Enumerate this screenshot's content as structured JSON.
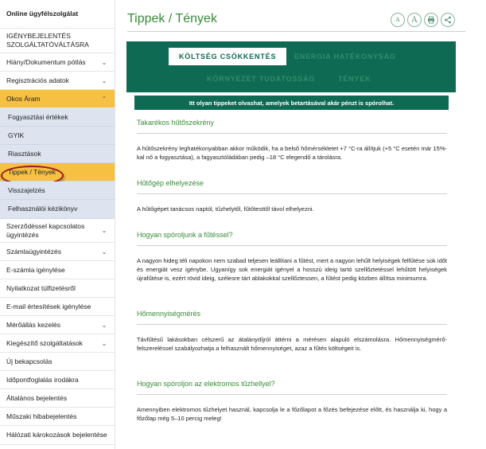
{
  "sidebar": {
    "items": [
      {
        "label": "Online ügyfélszolgálat",
        "bold": true
      },
      {
        "label": "IGÉNYBEJELENTÉS SZOLGÁLTATÓVÁLTÁSRA"
      },
      {
        "label": "Hiány/Dokumentum pótlás",
        "chevron": true
      },
      {
        "label": "Regisztrációs adatok",
        "chevron": true
      },
      {
        "label": "Okos Áram",
        "chevron": "up",
        "active": true
      },
      {
        "label": "Fogyasztási értékek",
        "sub": true
      },
      {
        "label": "GYIK",
        "sub": true
      },
      {
        "label": "Riasztások",
        "sub": true
      },
      {
        "label": "Tippek / Tények",
        "sub": true,
        "current": true
      },
      {
        "label": "Visszajelzés",
        "sub": true
      },
      {
        "label": "Felhasználói kézikönyv",
        "sub": true
      },
      {
        "label": "Szerződéssel kapcsolatos ügyintézés",
        "chevron": true
      },
      {
        "label": "Számlaügyintézés",
        "chevron": true
      },
      {
        "label": "E-számla igénylése"
      },
      {
        "label": "Nyilatkozat túlfizetésről"
      },
      {
        "label": "E-mail értesítések igénylése"
      },
      {
        "label": "Mérőállás kezelés",
        "chevron": true
      },
      {
        "label": "Kiegészítő szolgáltatások",
        "chevron": true
      },
      {
        "label": "Új bekapcsolás"
      },
      {
        "label": "Időpontfoglalás irodákra"
      },
      {
        "label": "Általános bejelentés"
      },
      {
        "label": "Műszaki hibabejelentés"
      },
      {
        "label": "Hálózati károkozások bejelentése"
      }
    ]
  },
  "main": {
    "title": "Tippek / Tények",
    "tools": [
      {
        "glyph": "A",
        "icon": "font-decrease-icon"
      },
      {
        "glyph": "A",
        "icon": "font-increase-icon"
      },
      {
        "glyph": "",
        "icon": "print-icon"
      },
      {
        "glyph": "",
        "icon": "share-icon"
      }
    ],
    "tabs": [
      "KÖLTSÉG CSÖKKENTÉS",
      "ENERGIA HATÉKONYSÁG",
      "KÖRNYEZET TUDATOSSÁG",
      "TÉNYEK"
    ],
    "info": "Itt olyan tippeket olvashat, amelyek betartásával akár pénzt is spórolhat.",
    "sections": [
      {
        "heading": "Takarékos hűtőszekrény",
        "text": "A hűtőszekrény leghatékonyabban akkor működik, ha a belső hőmérsékletet +7 °C-ra állítjuk (+5 °C esetén már 15%-kal nő a fogyasztása), a fagyasztóládában pedig –18 °C elegendő a tárolásra."
      },
      {
        "heading": "Hűtőgép elhelyezése",
        "text": "A hűtőgépet tanácsos naptól, tűzhelytől, fűtőtesttől távol elhelyezni."
      },
      {
        "heading": "Hogyan spóroljunk a fűtéssel?",
        "text": "A nagyon hideg téli napokon nem szabad teljesen leállítani a fűtést, mert a nagyon lehűlt helyiségek felfűtése sok időt és energiát vesz igénybe. Ugyanígy sok energiát igényel a hosszú ideig tartó szellőztetéssel lehűtött helyiségek újrafűtése is, ezért rövid ideig, szélesre tárt ablakokkal szellőztessen, a fűtést pedig közben állítsa minimumra."
      },
      {
        "heading": "Hőmennyiségmérés",
        "text": "Távfűtésű lakásokban célszerű az átalánydíjról áttérni a mérésen alapuló elszámolásra. Hőmennyiségmérő-felszereléssel szabályozhatja a felhasznált hőmennyiséget, azaz a fűtés költségeit is."
      },
      {
        "heading": "Hogyan spóroljon az elektromos tűzhellyel?",
        "text": "Amennyiben elektromos tűzhelyet használ, kapcsolja le a főzőlapot a főzés befejezése előtt, és használja ki, hogy a főzőlap még 5–10 percig meleg!"
      }
    ]
  }
}
